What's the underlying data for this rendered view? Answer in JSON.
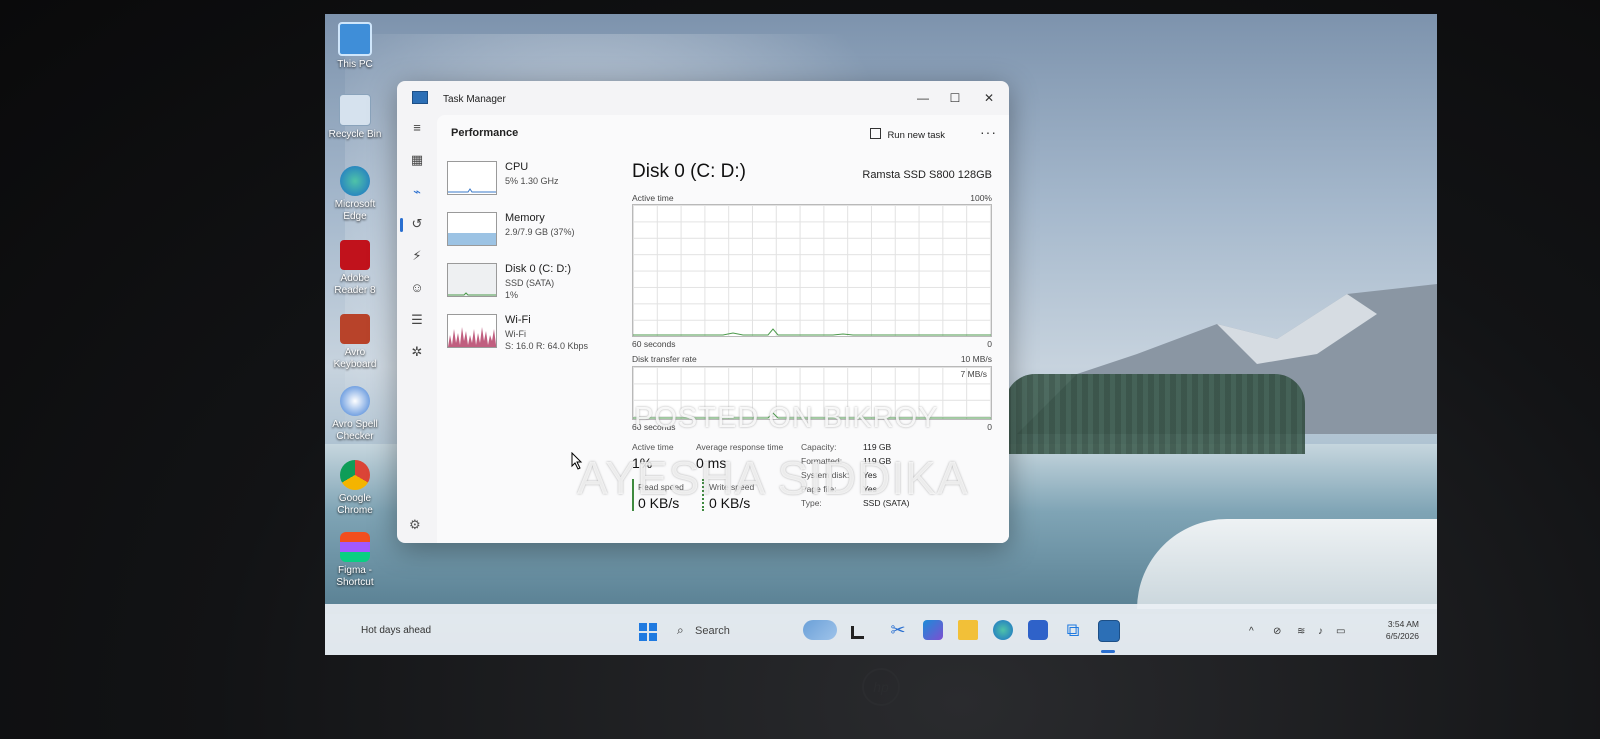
{
  "desktop": {
    "icons": [
      {
        "label": "This PC"
      },
      {
        "label": "Recycle Bin"
      },
      {
        "label": "Microsoft Edge"
      },
      {
        "label": "Adobe Reader 8"
      },
      {
        "label": "Avro Keyboard"
      },
      {
        "label": "Avro Spell Checker"
      },
      {
        "label": "Google Chrome"
      },
      {
        "label": "Figma - Shortcut"
      }
    ]
  },
  "task_manager": {
    "window_title": "Task Manager",
    "page_title": "Performance",
    "run_new_task_label": "Run new task",
    "more_label": "···",
    "perf_items": [
      {
        "name": "CPU",
        "sub1": "5%  1.30 GHz",
        "sub2": ""
      },
      {
        "name": "Memory",
        "sub1": "2.9/7.9 GB (37%)",
        "sub2": ""
      },
      {
        "name": "Disk 0 (C: D:)",
        "sub1": "SSD (SATA)",
        "sub2": "1%"
      },
      {
        "name": "Wi-Fi",
        "sub1": "Wi-Fi",
        "sub2": "S: 16.0  R: 64.0 Kbps"
      }
    ],
    "detail": {
      "title": "Disk 0 (C: D:)",
      "model": "Ramsta SSD S800 128GB",
      "active_time_label": "Active time",
      "active_time_max": "100%",
      "graph1_left": "60 seconds",
      "graph1_right": "0",
      "transfer_label": "Disk transfer rate",
      "transfer_max": "10 MB/s",
      "transfer_mid": "7 MB/s",
      "graph2_left": "60 seconds",
      "graph2_right": "0",
      "active_time_stat_label": "Active time",
      "active_time_stat": "1%",
      "avg_response_label": "Average response time",
      "avg_response": "0 ms",
      "read_speed_label": "Read speed",
      "read_speed": "0 KB/s",
      "write_speed_label": "Write speed",
      "write_speed": "0 KB/s",
      "props": [
        {
          "k": "Capacity:",
          "v": "119 GB"
        },
        {
          "k": "Formatted:",
          "v": "119 GB"
        },
        {
          "k": "System disk:",
          "v": "Yes"
        },
        {
          "k": "Page file:",
          "v": "Yes"
        },
        {
          "k": "Type:",
          "v": "SSD (SATA)"
        }
      ]
    }
  },
  "watermarks": {
    "line1": "POSTED ON BIKROY",
    "line2": "AYESHA SIDDIKA"
  },
  "taskbar": {
    "weather": "Hot days ahead",
    "search_placeholder": "Search",
    "time": "3:54 AM",
    "date": "6/5/2026"
  },
  "colors": {
    "accent": "#2a6fd0",
    "wifi_graph": "#b0365f",
    "memory_fill": "#9cc3e4"
  }
}
